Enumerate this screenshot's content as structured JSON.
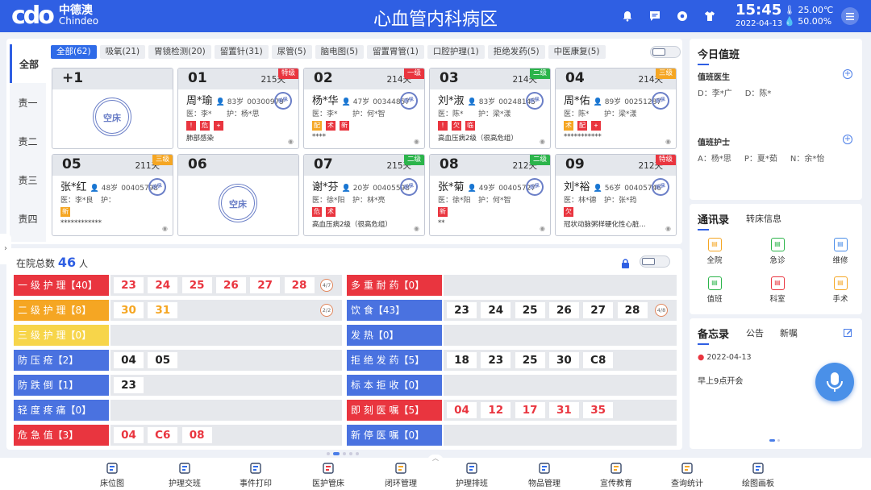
{
  "header": {
    "logo_mark": "cdo",
    "logo_cn": "中德澳",
    "logo_en": "Chindeo",
    "title": "心血管内科病区",
    "time": "15:45",
    "date": "2022-04-13",
    "temperature": "25.00℃",
    "humidity": "50.00%",
    "icons": [
      "bell-icon",
      "chat-icon",
      "settings-icon",
      "shirt-icon",
      "menu-icon"
    ]
  },
  "side_tabs": [
    "全部",
    "责一",
    "责二",
    "责三",
    "责四"
  ],
  "filter_tabs": [
    "全部(62)",
    "吸氧(21)",
    "胃镜检测(20)",
    "留置针(31)",
    "尿管(5)",
    "脑电图(5)",
    "留置胃管(1)",
    "口腔护理(1)",
    "拒绝发药(5)",
    "中医康复(5)"
  ],
  "seal_text": "空床",
  "seal_small": "医保",
  "beds": [
    {
      "num": "+1",
      "empty": true
    },
    {
      "num": "01",
      "days": "215天",
      "level": "特级",
      "level_color": "#e9353f",
      "name": "周*瑜",
      "age": "83岁",
      "id": "00300979",
      "doctor": "医：李*",
      "nurse": "护：杨*思",
      "tags": [
        [
          "!",
          "#e9353f"
        ],
        [
          "危",
          "#e9353f"
        ],
        [
          "ᚐ",
          "#e9353f"
        ]
      ],
      "diag": "肺部感染",
      "seal": true
    },
    {
      "num": "02",
      "days": "214天",
      "level": "一级",
      "level_color": "#e9353f",
      "name": "杨*华",
      "age": "47岁",
      "id": "00344857",
      "doctor": "医：李*",
      "nurse": "护：何*智",
      "tags": [
        [
          "配",
          "#f5a623"
        ],
        [
          "术",
          "#e9353f"
        ],
        [
          "新",
          "#e9353f"
        ]
      ],
      "diag": "****",
      "seal": true
    },
    {
      "num": "03",
      "days": "214天",
      "level": "二级",
      "level_color": "#2bb44a",
      "name": "刘*淑",
      "age": "83岁",
      "id": "00248145",
      "doctor": "医：陈*",
      "nurse": "护：梁*漾",
      "tags": [
        [
          "!",
          "#e9353f"
        ],
        [
          "欠",
          "#e9353f"
        ],
        [
          "临",
          "#e9353f"
        ]
      ],
      "diag": "高血压病2级（很高危组）",
      "seal": true
    },
    {
      "num": "04",
      "days": "214天",
      "level": "三级",
      "level_color": "#f5a623",
      "name": "周*佑",
      "age": "89岁",
      "id": "00251287",
      "doctor": "医：陈*",
      "nurse": "护：梁*漾",
      "tags": [
        [
          "术",
          "#f5a623"
        ],
        [
          "配",
          "#e9353f"
        ],
        [
          "ᚐ",
          "#e9353f"
        ]
      ],
      "diag": "***********",
      "seal": true
    },
    {
      "num": "05",
      "days": "211天",
      "level": "三级",
      "level_color": "#f5a623",
      "name": "张*红",
      "age": "48岁",
      "id": "00405798",
      "doctor": "医：李*良",
      "nurse": "护：",
      "tags": [
        [
          "新",
          "#f5a623"
        ]
      ],
      "diag": "************",
      "seal": true
    },
    {
      "num": "06",
      "empty": true
    },
    {
      "num": "07",
      "days": "215天",
      "level": "二级",
      "level_color": "#2bb44a",
      "name": "谢*芬",
      "age": "20岁",
      "id": "00405598",
      "doctor": "医：徐*阳",
      "nurse": "护：林*亮",
      "tags": [
        [
          "危",
          "#e9353f"
        ],
        [
          "术",
          "#e9353f"
        ]
      ],
      "diag": "高血压病2级（很高危组）",
      "seal": true
    },
    {
      "num": "08",
      "days": "212天",
      "level": "二级",
      "level_color": "#2bb44a",
      "name": "张*菊",
      "age": "49岁",
      "id": "00405727",
      "doctor": "医：徐*阳",
      "nurse": "护：何*智",
      "tags": [
        [
          "新",
          "#e9353f"
        ]
      ],
      "diag": "**",
      "seal": true
    },
    {
      "num": "09",
      "days": "212天",
      "level": "特级",
      "level_color": "#e9353f",
      "name": "刘*裕",
      "age": "56岁",
      "id": "00405746",
      "doctor": "医：林*德",
      "nurse": "护：张*筠",
      "tags": [
        [
          "欠",
          "#e9353f"
        ]
      ],
      "diag": "冠状动脉粥样硬化性心脏...",
      "seal": true
    }
  ],
  "census": {
    "label": "在院总数",
    "count": "46",
    "unit": "人"
  },
  "stats_left": [
    {
      "label": "一 级 护 理【40】",
      "color": "#e9353f",
      "chips": [
        "23",
        "24",
        "25",
        "26",
        "27",
        "28"
      ],
      "chip_color": "#e9353f",
      "page": "4/7"
    },
    {
      "label": "二 级 护 理【8】",
      "color": "#f5a623",
      "chips": [
        "30",
        "31"
      ],
      "chip_color": "#f5a623",
      "page": "2/2"
    },
    {
      "label": "三 级 护 理【0】",
      "color": "#f7d54a",
      "chips": [],
      "chip_color": "#333",
      "page": ""
    },
    {
      "label": "防 压 疮【2】",
      "color": "#4a72e0",
      "chips": [
        "04",
        "05"
      ],
      "chip_color": "#222",
      "page": ""
    },
    {
      "label": "防 跌 倒【1】",
      "color": "#4a72e0",
      "chips": [
        "23"
      ],
      "chip_color": "#222",
      "page": ""
    },
    {
      "label": "轻 度 疼 痛【0】",
      "color": "#4a72e0",
      "chips": [],
      "chip_color": "#222",
      "page": ""
    },
    {
      "label": "危 急 值【3】",
      "color": "#e9353f",
      "chips": [
        "04",
        "C6",
        "08"
      ],
      "chip_color": "#e9353f",
      "page": ""
    }
  ],
  "stats_right": [
    {
      "label": "多 重 耐 药【0】",
      "color": "#e9353f",
      "chips": [],
      "chip_color": "#e9353f",
      "page": ""
    },
    {
      "label": "饮 食【43】",
      "color": "#4a72e0",
      "chips": [
        "23",
        "24",
        "25",
        "26",
        "27",
        "28"
      ],
      "chip_color": "#222",
      "page": "4/8"
    },
    {
      "label": "发 热【0】",
      "color": "#4a72e0",
      "chips": [],
      "chip_color": "#222",
      "page": ""
    },
    {
      "label": "拒 绝 发 药【5】",
      "color": "#4a72e0",
      "chips": [
        "18",
        "23",
        "25",
        "30",
        "C8"
      ],
      "chip_color": "#222",
      "page": ""
    },
    {
      "label": "标 本 拒 收【0】",
      "color": "#4a72e0",
      "chips": [],
      "chip_color": "#222",
      "page": ""
    },
    {
      "label": "即 刻 医 嘱【5】",
      "color": "#e9353f",
      "chips": [
        "04",
        "12",
        "17",
        "31",
        "35"
      ],
      "chip_color": "#e9353f",
      "page": ""
    },
    {
      "label": "新 停 医 嘱【0】",
      "color": "#4a72e0",
      "chips": [],
      "chip_color": "#222",
      "page": ""
    }
  ],
  "duty": {
    "title": "今日值班",
    "doctor_title": "值班医生",
    "doctors": [
      "D：李*广",
      "D：陈*"
    ],
    "nurse_title": "值班护士",
    "nurses": [
      "A：杨*思",
      "P：夏*茹",
      "N：余*怡"
    ]
  },
  "contacts": {
    "title": "通讯录",
    "tab2": "转床信息",
    "items": [
      [
        "全院",
        "#f5a623"
      ],
      [
        "急诊",
        "#2bb44a"
      ],
      [
        "维修",
        "#4a8de8"
      ],
      [
        "值班",
        "#2bb44a"
      ],
      [
        "科室",
        "#e9353f"
      ],
      [
        "手术",
        "#f5a623"
      ]
    ]
  },
  "memo": {
    "title": "备忘录",
    "tab2": "公告",
    "tab3": "新嘱",
    "date": "2022-04-13",
    "text": "早上9点开会"
  },
  "bottom_nav": [
    "床位图",
    "护理交班",
    "事件打印",
    "医护管床",
    "闭环管理",
    "护理排班",
    "物品管理",
    "宣传教育",
    "查询统计",
    "绘图画板"
  ]
}
